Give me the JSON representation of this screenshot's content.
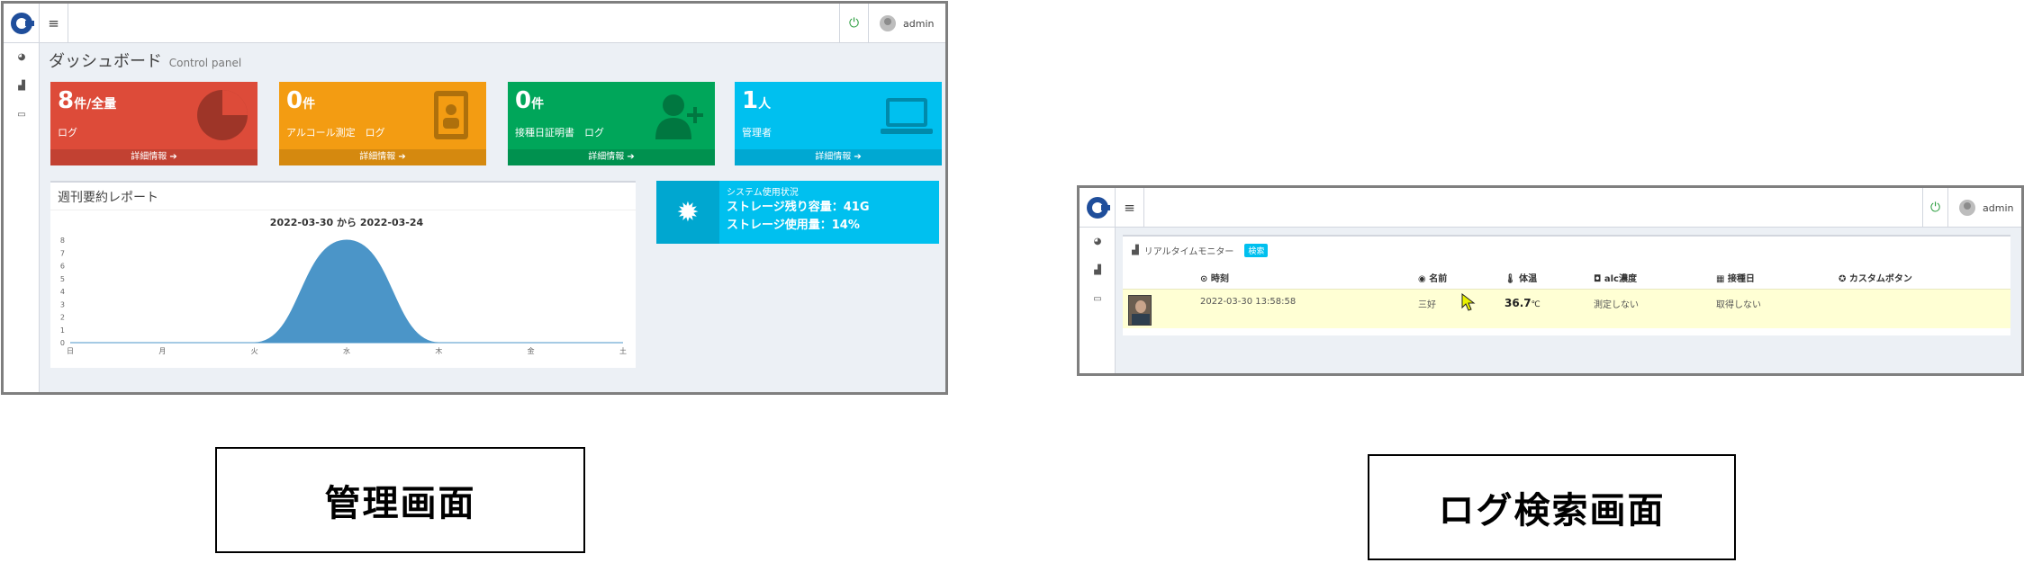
{
  "dashboard": {
    "user": "admin",
    "title": "ダッシュボード",
    "subtitle": "Control panel",
    "boxes": [
      {
        "num": "8",
        "suffix": "件/全量",
        "label": "ログ",
        "footer": "詳細情報 ➔",
        "color": "#dd4b39",
        "icon": "pie-chart-icon"
      },
      {
        "num": "0",
        "suffix": "件",
        "label": "アルコール測定　ログ",
        "footer": "詳細情報 ➔",
        "color": "#f39c12",
        "icon": "id-badge-icon"
      },
      {
        "num": "0",
        "suffix": "件",
        "label": "接種日証明書　ログ",
        "footer": "詳細情報 ➔",
        "color": "#00a65a",
        "icon": "user-plus-icon"
      },
      {
        "num": "1",
        "suffix": "人",
        "label": "管理者",
        "footer": "詳細情報 ➔",
        "color": "#00c0ef",
        "icon": "laptop-icon"
      }
    ],
    "report": {
      "title": "週刊要約レポート"
    },
    "system": {
      "title": "システム使用状況",
      "line1": "ストレージ残り容量：41G",
      "line2": "ストレージ使用量：14%"
    }
  },
  "chart_data": {
    "type": "area",
    "title": "2022-03-30 から 2022-03-24",
    "categories": [
      "日",
      "月",
      "火",
      "水",
      "木",
      "金",
      "土"
    ],
    "values": [
      0,
      0,
      0,
      8,
      0,
      0,
      0
    ],
    "ylim": [
      0,
      8
    ],
    "yticks": [
      "0",
      "1",
      "2",
      "3",
      "4",
      "5",
      "6",
      "7",
      "8"
    ],
    "color": "#4b95c8",
    "grid": false
  },
  "log_search": {
    "user": "admin",
    "panel_title": "リアルタイムモニター",
    "badge": "検索",
    "headers": [
      "⊙ 時刻",
      "◉ 名前",
      "🌡 体温",
      "◘ alc濃度",
      "▦ 接種日",
      "✪ カスタムボタン"
    ],
    "row": {
      "time": "2022-03-30 13:58:58",
      "name": "三好",
      "temp": "36.7",
      "temp_unit": "℃",
      "alc": "測定しない",
      "vacc": "取得しない",
      "custom": ""
    }
  },
  "captions": {
    "left": "管理画面",
    "right": "ログ検索画面"
  }
}
